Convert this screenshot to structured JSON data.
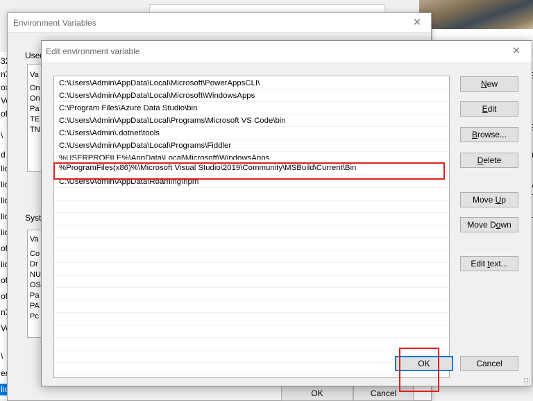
{
  "background": {
    "left_strip_rows": [
      "32",
      "n3",
      "ox",
      "Vel",
      "oft",
      "\\",
      "d",
      "lic",
      "lic",
      "lic",
      "lic",
      "lic",
      "oft",
      "lic",
      "oft",
      "oft",
      "n3",
      "Vel",
      "\\",
      "en",
      "lic"
    ],
    "right_fragments": [
      "E",
      "S",
      "u",
      "M"
    ]
  },
  "env_vars_window": {
    "title": "Environment Variables",
    "user_section_label": "User",
    "user_header": "Va",
    "user_rows": [
      "On",
      "On",
      "Pa",
      "TE",
      "TN"
    ],
    "system_section_label": "Syste",
    "system_header": "Va",
    "system_rows": [
      "Co",
      "Dr",
      "NU",
      "OS",
      "Pa",
      "PA",
      "Pc"
    ],
    "ok_label": "OK",
    "cancel_label": "Cancel"
  },
  "edit_window": {
    "title": "Edit environment variable",
    "paths": [
      "C:\\Users\\Admin\\AppData\\Local\\Microsoft\\PowerAppsCLI\\",
      "C:\\Users\\Admin\\AppData\\Local\\Microsoft\\WindowsApps",
      "C:\\Program Files\\Azure Data Studio\\bin",
      "C:\\Users\\Admin\\AppData\\Local\\Programs\\Microsoft VS Code\\bin",
      "C:\\Users\\Admin\\.dotnet\\tools",
      "C:\\Users\\Admin\\AppData\\Local\\Programs\\Fiddler",
      "%USERPROFILE%\\AppData\\Local\\Microsoft\\WindowsApps",
      "%ProgramFiles(x86)%\\Microsoft Visual Studio\\2019\\Community\\MSBuild\\Current\\Bin",
      "C:\\Users\\Admin\\AppData\\Roaming\\npm"
    ],
    "buttons": {
      "new": {
        "pre": "",
        "key": "N",
        "post": "ew"
      },
      "edit": {
        "pre": "",
        "key": "E",
        "post": "dit"
      },
      "browse": {
        "pre": "",
        "key": "B",
        "post": "rowse..."
      },
      "delete": {
        "pre": "",
        "key": "D",
        "post": "elete"
      },
      "move_up": {
        "pre": "Move ",
        "key": "U",
        "post": "p"
      },
      "move_down": {
        "pre": "Move D",
        "key": "o",
        "post": "wn"
      },
      "edit_text": {
        "pre": "Edit ",
        "key": "t",
        "post": "ext..."
      }
    },
    "ok_label": "OK",
    "cancel_label": "Cancel"
  },
  "icons": {
    "close": "close-icon",
    "resize": "resize-grip-icon"
  },
  "colors": {
    "highlight_box": "#e0201c",
    "accent": "#0078d7"
  }
}
